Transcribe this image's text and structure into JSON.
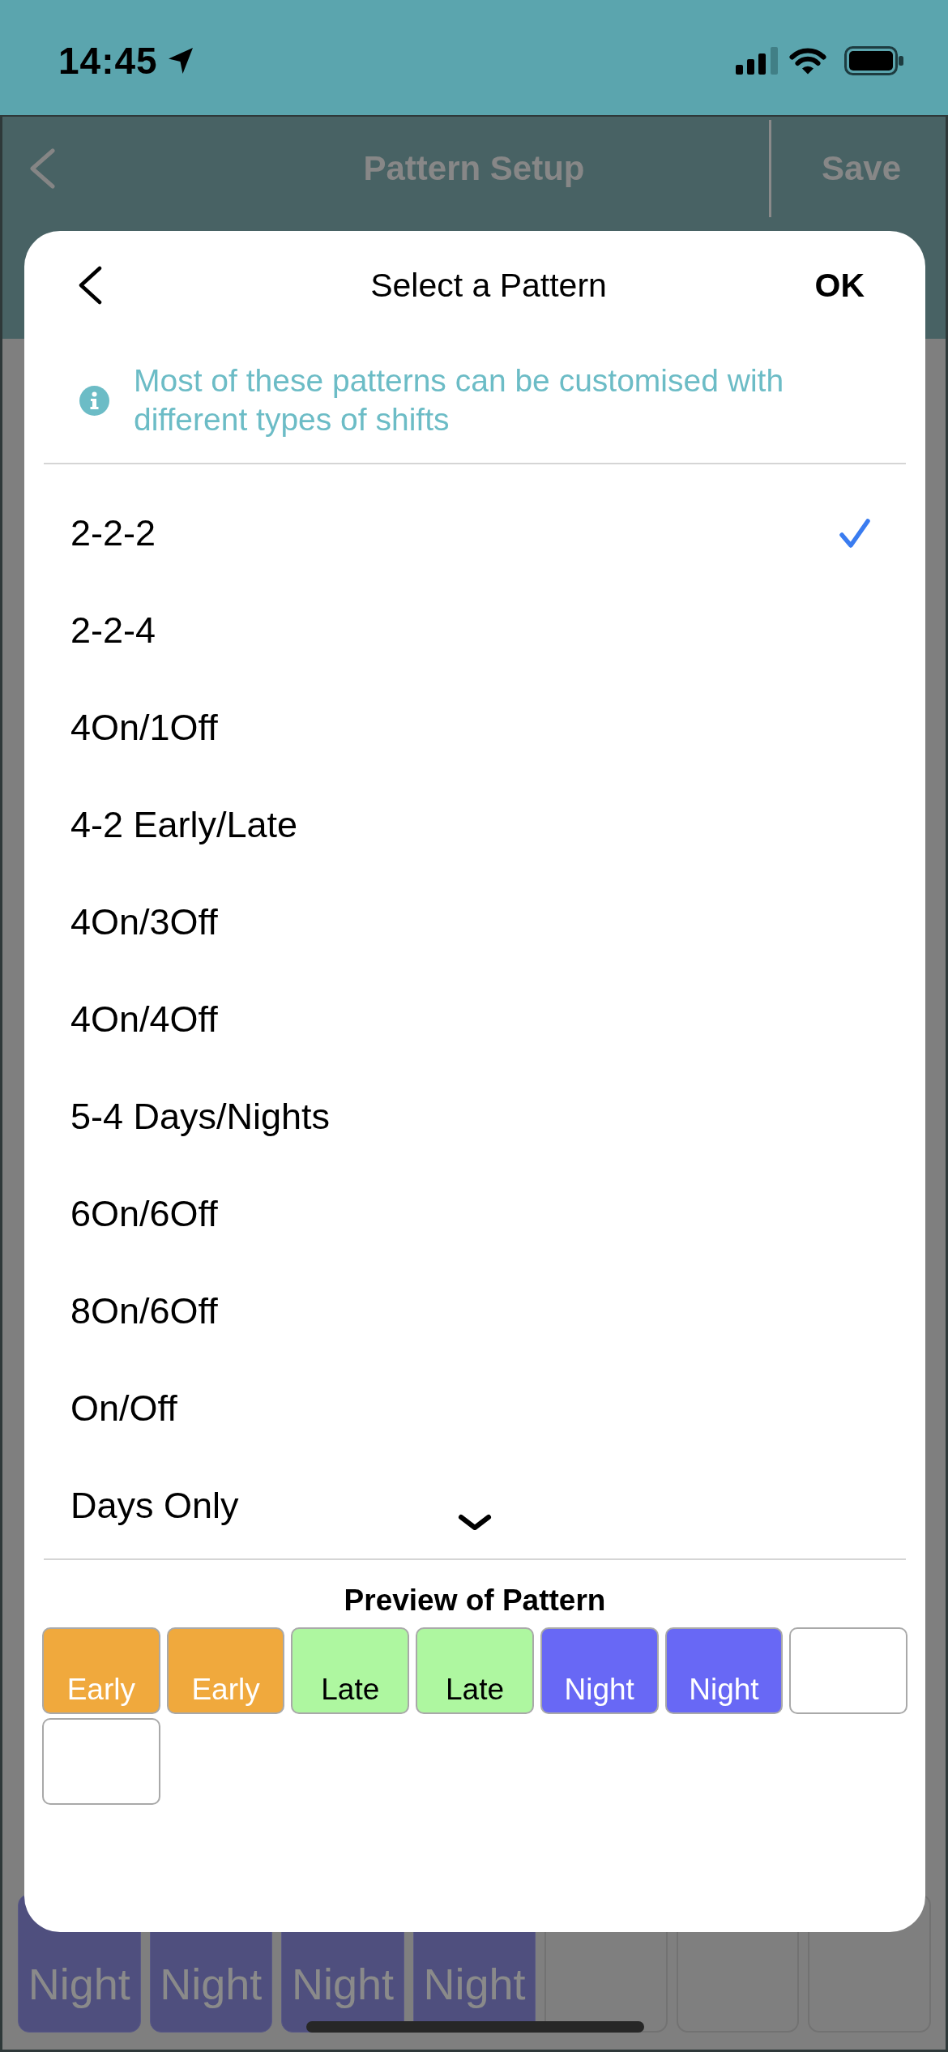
{
  "status_bar": {
    "time": "14:45"
  },
  "app_header": {
    "title": "Pattern Setup",
    "action": "Save"
  },
  "background_row": [
    {
      "kind": "shift",
      "label": "Night"
    },
    {
      "kind": "shift",
      "label": "Night"
    },
    {
      "kind": "shift",
      "label": "Night"
    },
    {
      "kind": "shift",
      "label": "Night"
    },
    {
      "kind": "empty"
    },
    {
      "kind": "empty"
    },
    {
      "kind": "empty"
    }
  ],
  "dialog": {
    "title": "Select a Pattern",
    "confirm": "OK",
    "info": "Most of these patterns can be customised with different types of shifts",
    "patterns": [
      {
        "label": "2-2-2",
        "selected": true
      },
      {
        "label": "2-2-4",
        "selected": false
      },
      {
        "label": "4On/1Off",
        "selected": false
      },
      {
        "label": "4-2 Early/Late",
        "selected": false
      },
      {
        "label": "4On/3Off",
        "selected": false
      },
      {
        "label": "4On/4Off",
        "selected": false
      },
      {
        "label": "5-4 Days/Nights",
        "selected": false
      },
      {
        "label": "6On/6Off",
        "selected": false
      },
      {
        "label": "8On/6Off",
        "selected": false
      },
      {
        "label": "On/Off",
        "selected": false
      },
      {
        "label": "Days Only",
        "selected": false
      }
    ],
    "preview": {
      "title": "Preview of Pattern",
      "cells": [
        {
          "kind": "shift",
          "label": "Early",
          "color": "#f0a93d"
        },
        {
          "kind": "shift",
          "label": "Early",
          "color": "#f0a93d"
        },
        {
          "kind": "shift",
          "label": "Late",
          "color": "#aef7a0"
        },
        {
          "kind": "shift",
          "label": "Late",
          "color": "#aef7a0"
        },
        {
          "kind": "shift",
          "label": "Night",
          "color": "#6868f5"
        },
        {
          "kind": "shift",
          "label": "Night",
          "color": "#6868f5"
        },
        {
          "kind": "empty"
        },
        {
          "kind": "empty"
        }
      ]
    }
  }
}
